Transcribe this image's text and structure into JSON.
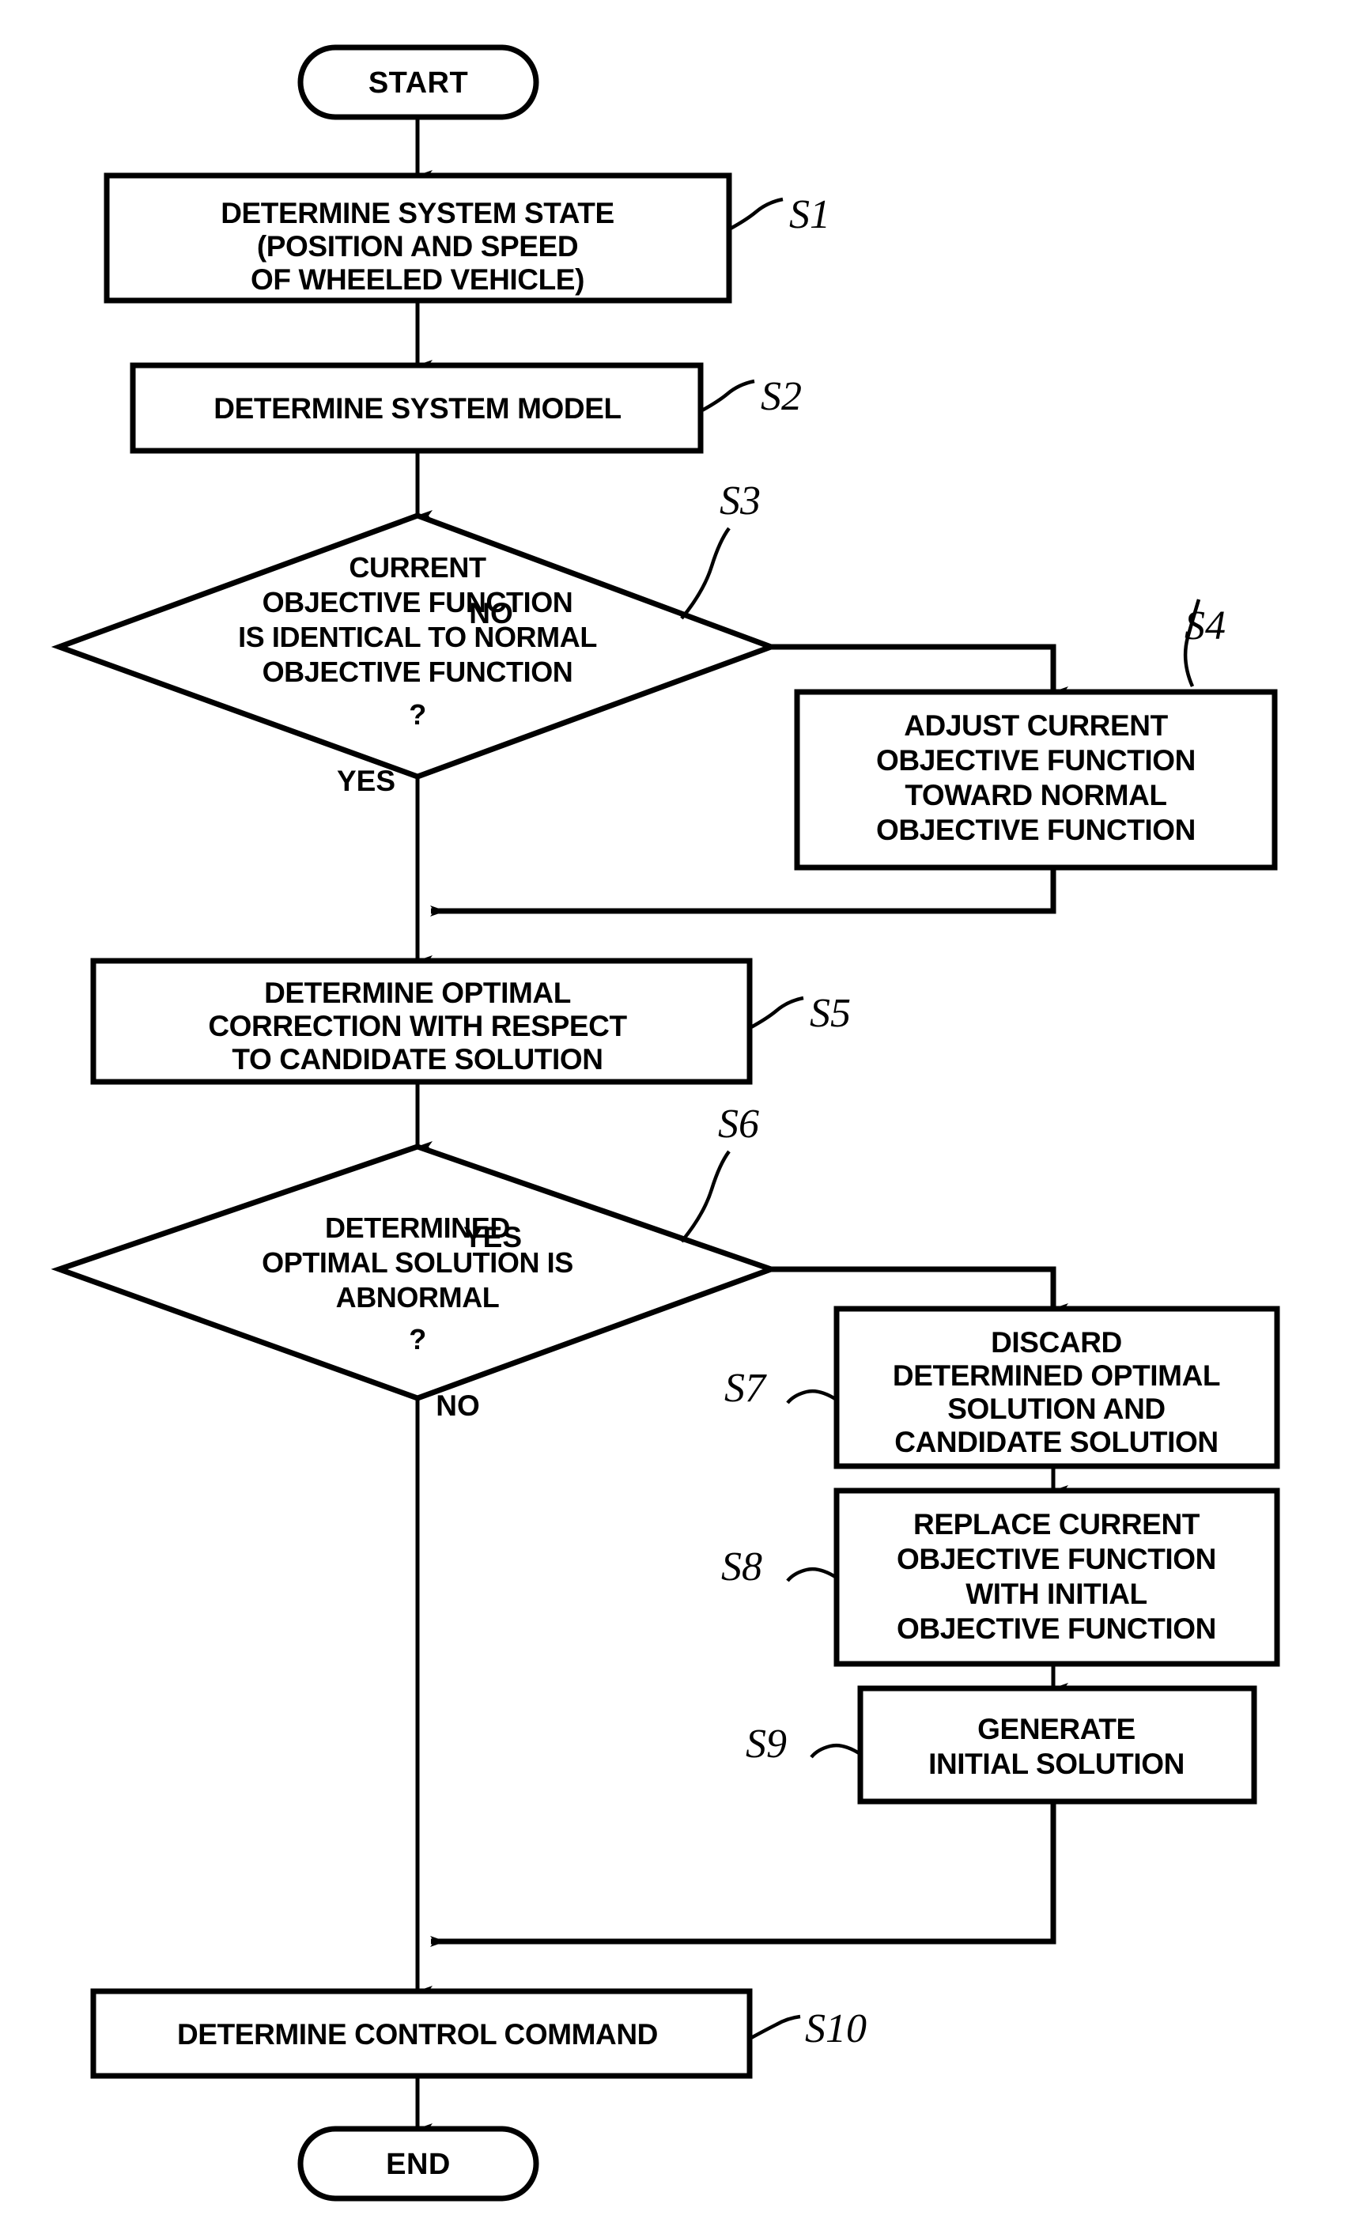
{
  "diagram": {
    "type": "flowchart",
    "title": "",
    "nodes": [
      {
        "id": "start",
        "kind": "terminator",
        "label": "START"
      },
      {
        "id": "s1",
        "kind": "process",
        "ref": "S1",
        "lines": [
          "DETERMINE SYSTEM STATE",
          "(POSITION AND SPEED",
          "OF WHEELED VEHICLE)"
        ]
      },
      {
        "id": "s2",
        "kind": "process",
        "ref": "S2",
        "lines": [
          "DETERMINE SYSTEM MODEL"
        ]
      },
      {
        "id": "s3",
        "kind": "decision",
        "ref": "S3",
        "lines": [
          "CURRENT",
          "OBJECTIVE FUNCTION",
          "IS IDENTICAL TO NORMAL",
          "OBJECTIVE FUNCTION",
          "?"
        ]
      },
      {
        "id": "s4",
        "kind": "process",
        "ref": "S4",
        "lines": [
          "ADJUST CURRENT",
          "OBJECTIVE FUNCTION",
          "TOWARD NORMAL",
          "OBJECTIVE FUNCTION"
        ]
      },
      {
        "id": "s5",
        "kind": "process",
        "ref": "S5",
        "lines": [
          "DETERMINE OPTIMAL",
          "CORRECTION WITH RESPECT",
          "TO CANDIDATE SOLUTION"
        ]
      },
      {
        "id": "s6",
        "kind": "decision",
        "ref": "S6",
        "lines": [
          "DETERMINED",
          "OPTIMAL SOLUTION IS",
          "ABNORMAL",
          "?"
        ]
      },
      {
        "id": "s7",
        "kind": "process",
        "ref": "S7",
        "lines": [
          "DISCARD",
          "DETERMINED OPTIMAL",
          "SOLUTION AND",
          "CANDIDATE SOLUTION"
        ]
      },
      {
        "id": "s8",
        "kind": "process",
        "ref": "S8",
        "lines": [
          "REPLACE CURRENT",
          "OBJECTIVE FUNCTION",
          "WITH INITIAL",
          "OBJECTIVE FUNCTION"
        ]
      },
      {
        "id": "s9",
        "kind": "process",
        "ref": "S9",
        "lines": [
          "GENERATE",
          "INITIAL SOLUTION"
        ]
      },
      {
        "id": "s10",
        "kind": "process",
        "ref": "S10",
        "lines": [
          "DETERMINE CONTROL COMMAND"
        ]
      },
      {
        "id": "end",
        "kind": "terminator",
        "label": "END"
      }
    ],
    "branch_labels": {
      "s3_no": "NO",
      "s3_yes": "YES",
      "s6_yes": "YES",
      "s6_no": "NO"
    },
    "refs": {
      "s1": "S1",
      "s2": "S2",
      "s3": "S3",
      "s4": "S4",
      "s5": "S5",
      "s6": "S6",
      "s7": "S7",
      "s8": "S8",
      "s9": "S9",
      "s10": "S10"
    },
    "colors": {
      "line": "#000000",
      "fill": "#ffffff",
      "text": "#000000"
    }
  }
}
